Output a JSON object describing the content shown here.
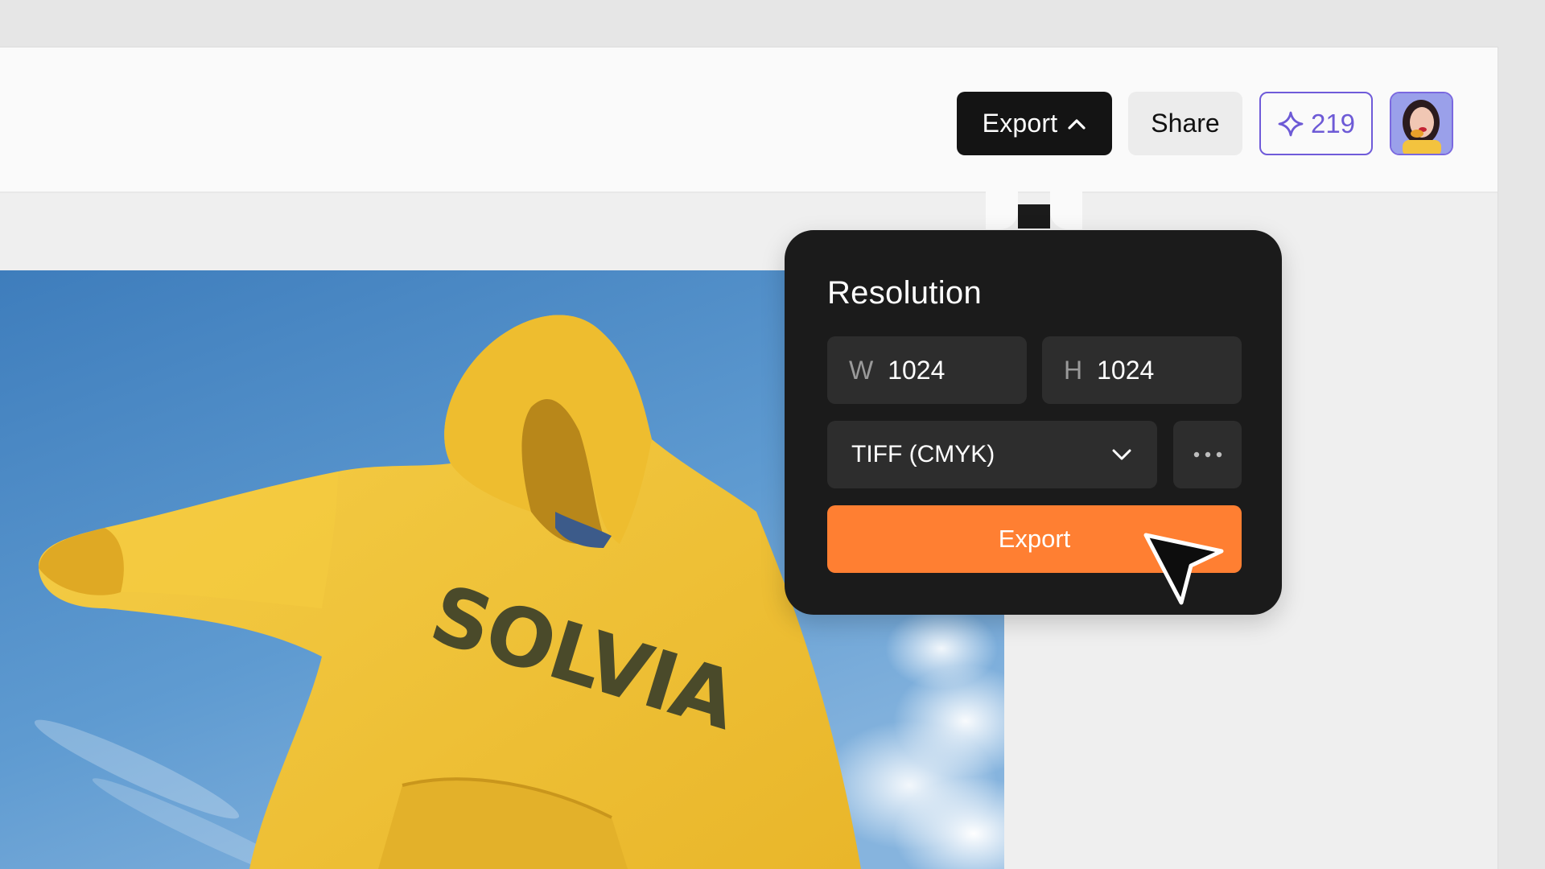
{
  "toolbar": {
    "export_label": "Export",
    "share_label": "Share",
    "credits": "219",
    "credits_icon": "sparkle-icon",
    "avatar_icon": "user-avatar"
  },
  "canvas": {
    "image_text": "SOLVIA"
  },
  "export_panel": {
    "title": "Resolution",
    "width_label": "W",
    "width_value": "1024",
    "height_label": "H",
    "height_value": "1024",
    "format_selected": "TIFF (CMYK)",
    "more_icon": "ellipsis-icon",
    "export_button_label": "Export"
  },
  "colors": {
    "accent": "#ff7f32",
    "credits_purple": "#6d5ad6",
    "panel_bg": "#1b1b1b",
    "sky_blue": "#4a89c6",
    "hoodie_yellow": "#f2c232"
  }
}
